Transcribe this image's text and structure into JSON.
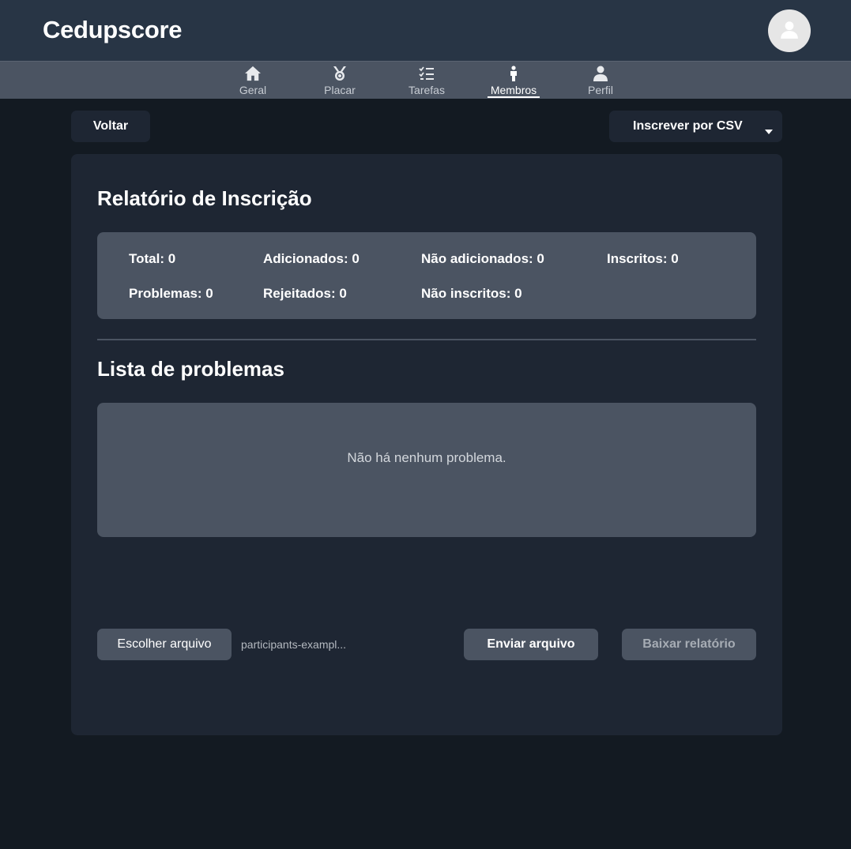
{
  "app": {
    "title": "Cedupscore"
  },
  "header": {
    "avatar_icon": "user-avatar-icon"
  },
  "nav": {
    "items": [
      {
        "label": "Geral",
        "icon": "home-icon"
      },
      {
        "label": "Placar",
        "icon": "medal-icon"
      },
      {
        "label": "Tarefas",
        "icon": "task-list-icon"
      },
      {
        "label": "Membros",
        "icon": "person-icon",
        "active": true
      },
      {
        "label": "Perfil",
        "icon": "user-icon"
      }
    ]
  },
  "toolbar": {
    "back_label": "Voltar",
    "enroll_csv_label": "Inscrever por CSV"
  },
  "report": {
    "title": "Relatório de Inscrição",
    "stats": {
      "total": "Total: 0",
      "added": "Adicionados: 0",
      "not_added": "Não adicionados: 0",
      "enrolled": "Inscritos: 0",
      "problems": "Problemas: 0",
      "rejected": "Rejeitados: 0",
      "not_enrolled": "Não inscritos: 0"
    }
  },
  "problems": {
    "title": "Lista de problemas",
    "empty_message": "Não há nenhum problema."
  },
  "actions": {
    "choose_file_label": "Escolher arquivo",
    "file_name": "participants-exampl...",
    "send_label": "Enviar arquivo",
    "download_label": "Baixar relatório"
  },
  "colors": {
    "background": "#131a22",
    "header": "#283545",
    "nav": "#4b5462",
    "card": "#1e2633",
    "box": "#4b5462"
  }
}
